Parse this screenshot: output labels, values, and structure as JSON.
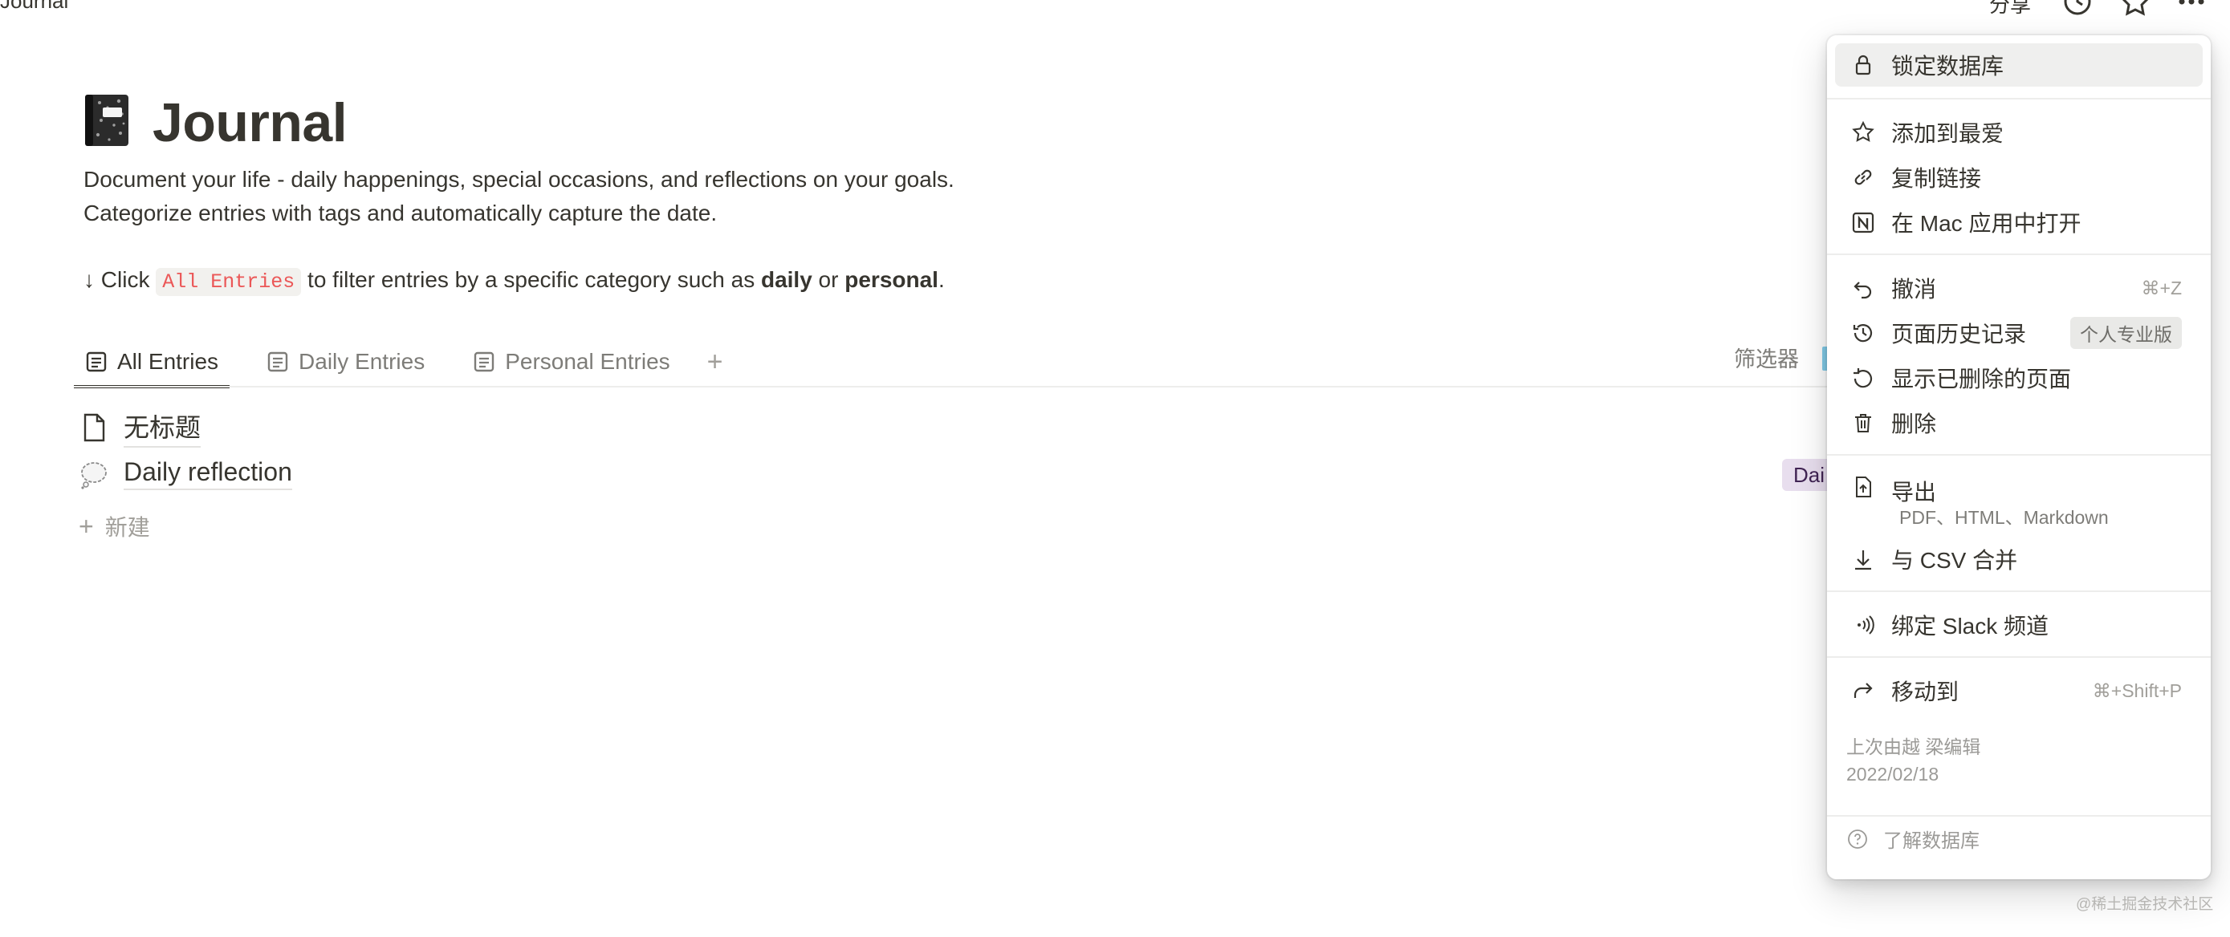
{
  "topbar": {
    "title": "Journal",
    "share_label": "分享",
    "icons": [
      "clock-icon",
      "star-icon",
      "more-icon"
    ]
  },
  "page": {
    "icon": "notebook-icon",
    "title": "Journal",
    "description_line1": "Document your life - daily happenings, special occasions, and reflections on your goals.",
    "description_line2": "Categorize entries with tags and automatically capture the date.",
    "hint": {
      "arrow": "↓",
      "pre": " Click ",
      "code": "All Entries",
      "mid": " to filter entries by a specific category such as ",
      "bold1": "daily",
      "or": " or ",
      "bold2": "personal",
      "end": "."
    }
  },
  "tabs": [
    {
      "label": "All Entries",
      "active": true
    },
    {
      "label": "Daily Entries",
      "active": false
    },
    {
      "label": "Personal Entries",
      "active": false
    }
  ],
  "tab_add": "+",
  "filter_label": "筛选器",
  "rows": [
    {
      "name": "无标题",
      "icon": "page-icon"
    },
    {
      "name": "Daily reflection",
      "icon": "thought-bubble-icon",
      "tag": "Dai"
    }
  ],
  "new_row_label": "新建",
  "menu": {
    "lock": "锁定数据库",
    "favorite": "添加到最爱",
    "copy_link": "复制链接",
    "open_mac": "在 Mac 应用中打开",
    "undo": "撤消",
    "undo_shortcut": "⌘+Z",
    "history": "页面历史记录",
    "history_badge": "个人专业版",
    "show_deleted": "显示已删除的页面",
    "delete": "删除",
    "export": "导出",
    "export_sub": "PDF、HTML、Markdown",
    "merge_csv": "与 CSV 合并",
    "slack": "绑定 Slack 频道",
    "move_to": "移动到",
    "move_shortcut": "⌘+Shift+P",
    "last_edited": "上次由越 梁编辑",
    "last_edited_date": "2022/02/18",
    "learn": "了解数据库"
  },
  "watermark": "@稀土掘金技术社区",
  "colors": {
    "accent": "#37352f",
    "code_red": "#eb5757",
    "tag_purple": "#e8deee"
  }
}
